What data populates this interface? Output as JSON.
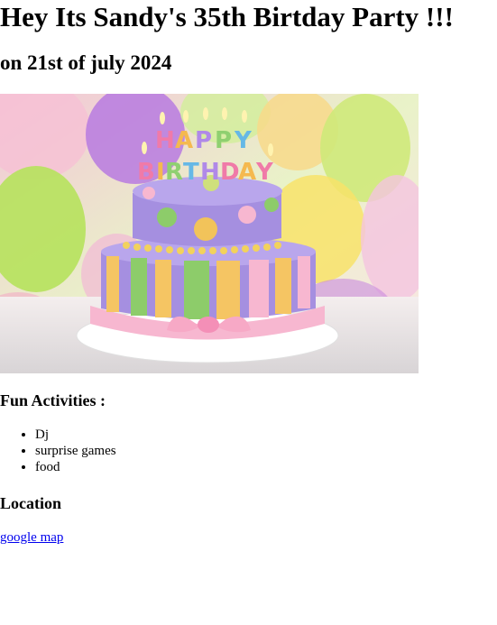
{
  "header": {
    "title": "Hey Its Sandy's 35th Birtday Party !!!",
    "date": "on 21st of july 2024"
  },
  "hero_image": {
    "icon": "birthday-cake-image",
    "candle_text": "HAPPY BIRTHDAY"
  },
  "activities": {
    "heading": "Fun Activities :",
    "items": [
      "Dj",
      "surprise games",
      "food"
    ]
  },
  "location": {
    "heading": "Location",
    "link_text": "google map"
  },
  "colors": {
    "link": "#0000ee",
    "text": "#000000"
  }
}
